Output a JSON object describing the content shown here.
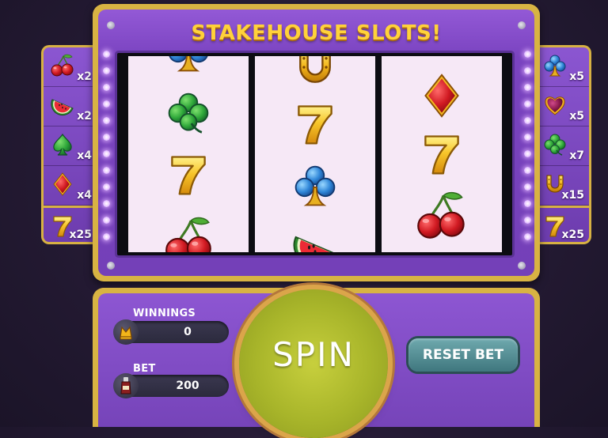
{
  "game": {
    "title": "STAKEHOUSE SLOTS!"
  },
  "paytable_left": [
    {
      "symbol": "cherry-icon",
      "multiplier": "x2"
    },
    {
      "symbol": "watermelon-icon",
      "multiplier": "x2"
    },
    {
      "symbol": "spade-icon",
      "multiplier": "x4"
    },
    {
      "symbol": "diamond-icon",
      "multiplier": "x4"
    },
    {
      "symbol": "seven-icon",
      "multiplier": "x25"
    }
  ],
  "paytable_right": [
    {
      "symbol": "club-icon",
      "multiplier": "x5"
    },
    {
      "symbol": "heart-icon",
      "multiplier": "x5"
    },
    {
      "symbol": "clover-icon",
      "multiplier": "x7"
    },
    {
      "symbol": "horseshoe-icon",
      "multiplier": "x15"
    },
    {
      "symbol": "seven-icon",
      "multiplier": "x25"
    }
  ],
  "reels": [
    [
      "club-icon",
      "clover-icon",
      "seven-icon",
      "cherry-icon"
    ],
    [
      "horseshoe-icon",
      "seven-icon",
      "club-icon",
      "watermelon-icon"
    ],
    [
      "diamond-icon",
      "seven-icon",
      "cherry-icon"
    ]
  ],
  "stats": {
    "winnings_label": "WINNINGS",
    "winnings_value": "0",
    "bet_label": "BET",
    "bet_value": "200"
  },
  "controls": {
    "spin_label": "SPIN",
    "reset_label": "RESET BET"
  },
  "colors": {
    "frame_gold": "#d8b343",
    "machine_purple": "#7a43c0",
    "title_yellow": "#ffd23a",
    "spin_green": "#a8b52a",
    "reset_teal": "#4f8a90"
  }
}
